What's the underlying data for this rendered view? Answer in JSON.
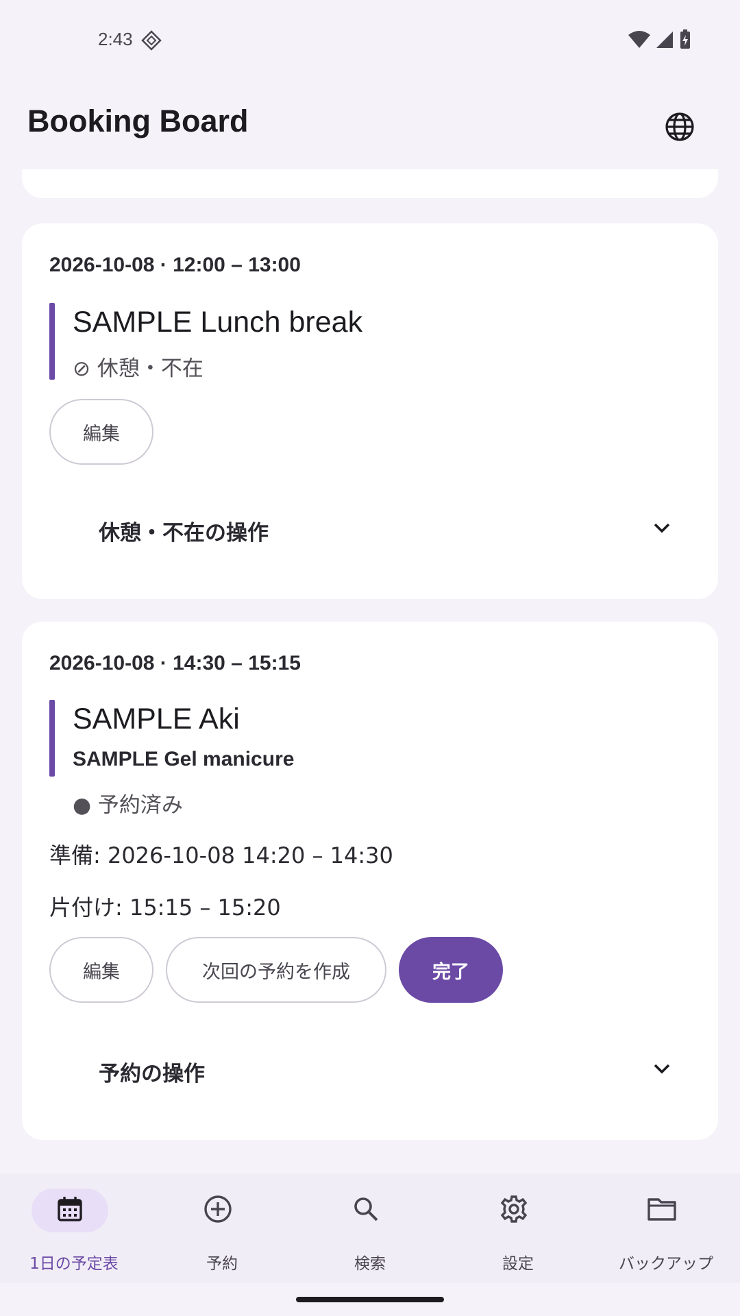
{
  "status_bar": {
    "time": "2:43"
  },
  "app_bar": {
    "title": "Booking Board"
  },
  "cards": [
    {
      "time": "2026-10-08 · 12:00 – 13:00",
      "title": "SAMPLE Lunch break",
      "subtitle": "⊘ 休憩・不在",
      "edit_label": "編集",
      "expander_label": "休憩・不在の操作"
    },
    {
      "time": "2026-10-08 · 14:30 – 15:15",
      "title": "SAMPLE Aki",
      "service": "SAMPLE Gel manicure",
      "status": "● 予約済み",
      "prep": "準備: 2026-10-08 14:20 – 14:30",
      "cleanup": "片付け: 15:15 – 15:20",
      "edit_label": "編集",
      "next_label": "次回の予約を作成",
      "complete_label": "完了",
      "expander_label": "予約の操作"
    }
  ],
  "nav": [
    {
      "label": "1日の予定表",
      "icon": "calendar-icon",
      "active": true
    },
    {
      "label": "予約",
      "icon": "add-circle-icon",
      "active": false
    },
    {
      "label": "検索",
      "icon": "search-icon",
      "active": false
    },
    {
      "label": "設定",
      "icon": "gear-icon",
      "active": false
    },
    {
      "label": "バックアップ",
      "icon": "folder-icon",
      "active": false
    }
  ],
  "colors": {
    "accent": "#6b4aa6",
    "background": "#f5f2f9",
    "nav_active_pill": "#e8def8"
  }
}
